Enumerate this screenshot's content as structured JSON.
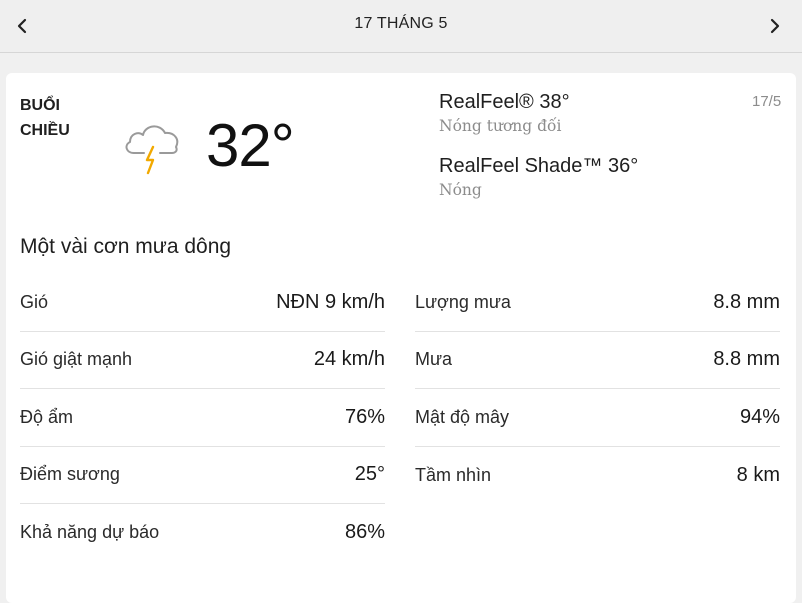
{
  "header": {
    "date_title": "17 THÁNG 5",
    "prev_icon": "chevron-left-icon",
    "next_icon": "chevron-right-icon"
  },
  "current": {
    "daypart_line1": "BUỔI",
    "daypart_line2": "CHIỀU",
    "icon": "thunderstorm-cloud-icon",
    "temperature": "32°",
    "short_date": "17/5",
    "realfeel_label": "RealFeel® 38°",
    "realfeel_phrase": "Nóng tương đối",
    "realfeel_shade_label": "RealFeel Shade™ 36°",
    "realfeel_shade_phrase": "Nóng",
    "phrase": "Một vài cơn mưa dông"
  },
  "details_left": [
    {
      "label": "Gió",
      "value": "NĐN 9 km/h"
    },
    {
      "label": "Gió giật mạnh",
      "value": "24 km/h"
    },
    {
      "label": "Độ ẩm",
      "value": "76%"
    },
    {
      "label": "Điểm sương",
      "value": "25°"
    },
    {
      "label": "Khả năng dự báo",
      "value": "86%"
    }
  ],
  "details_right": [
    {
      "label": "Lượng mưa",
      "value": "8.8 mm"
    },
    {
      "label": "Mưa",
      "value": "8.8 mm"
    },
    {
      "label": "Mật độ mây",
      "value": "94%"
    },
    {
      "label": "Tầm nhìn",
      "value": "8 km"
    }
  ],
  "colors": {
    "bolt": "#f2a900",
    "cloud_stroke": "#9a9a9a",
    "muted_text": "#8c8c8c"
  }
}
